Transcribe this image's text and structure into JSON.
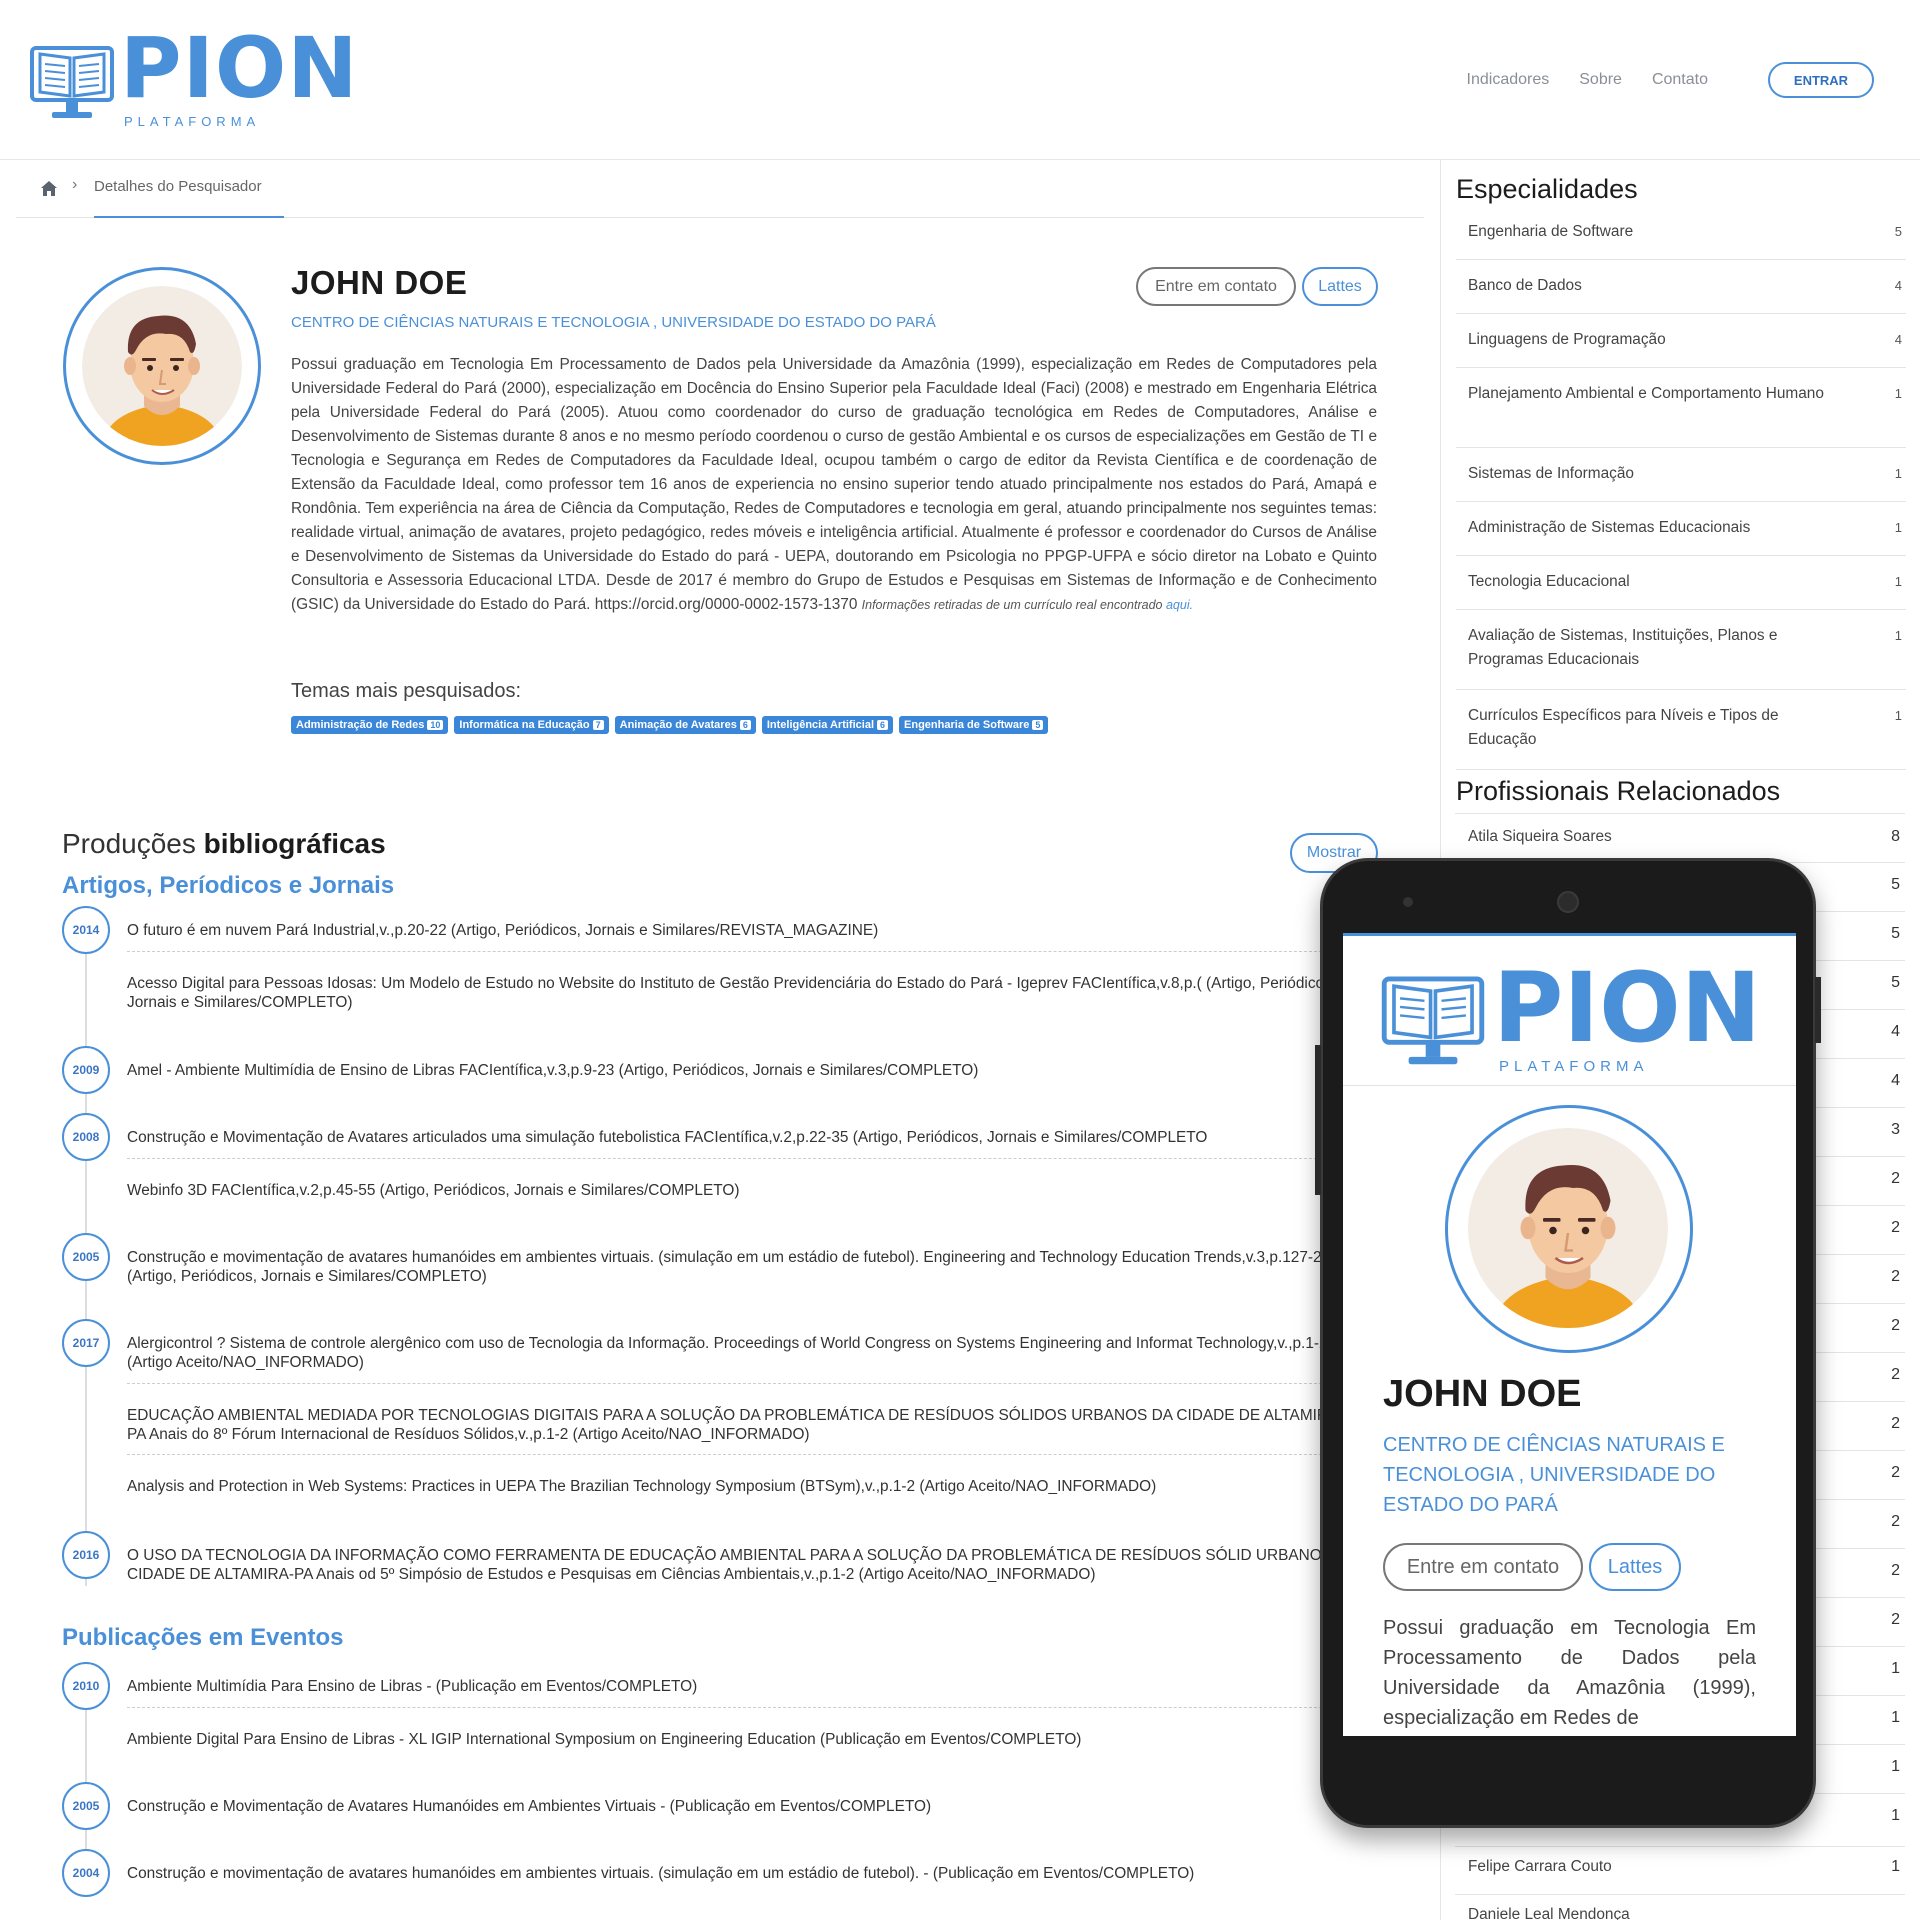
{
  "header": {
    "logo_word": "PION",
    "logo_sub": "PLATAFORMA",
    "nav": [
      "Indicadores",
      "Sobre",
      "Contato"
    ],
    "login_label": "ENTRAR"
  },
  "breadcrumb": {
    "label": "Detalhes do Pesquisador"
  },
  "profile": {
    "name": "JOHN DOE",
    "affiliation": "CENTRO DE CIÊNCIAS NATURAIS E TECNOLOGIA  , UNIVERSIDADE DO ESTADO DO PARÁ",
    "contact_label": "Entre em contato",
    "lattes_label": "Lattes",
    "bio": "Possui graduação em Tecnologia Em Processamento de Dados pela Universidade da Amazônia (1999), especialização em Redes de Computadores pela Universidade Federal do Pará (2000), especialização em Docência do Ensino Superior pela Faculdade Ideal (Faci) (2008) e mestrado em Engenharia Elétrica pela Universidade Federal do Pará (2005). Atuou como coordenador do curso de graduação tecnológica em Redes de Computadores, Análise e Desenvolvimento de Sistemas durante 8 anos e no mesmo período coordenou o curso de gestão Ambiental e os cursos de especializações em Gestão de TI e Tecnologia e Segurança em Redes de Computadores da Faculdade Ideal, ocupou também o cargo de editor da Revista Científica e de coordenação de Extensão da Faculdade Ideal, como professor tem 16 anos de experiencia no ensino superior tendo atuado principalmente nos estados do Pará, Amapá e Rondônia. Tem experiência na área de Ciência da Computação, Redes de Computadores e tecnologia em geral, atuando principalmente nos seguintes temas: realidade virtual, animação de avatares, projeto pedagógico, redes móveis e inteligência artificial. Atualmente é professor e coordenador do Cursos de Análise e Desenvolvimento de Sistemas da Universidade do Estado do pará - UEPA, doutorando em Psicologia no PPGP-UFPA e sócio diretor na Lobato e Quinto Consultoria e Assessoria Educacional LTDA. Desde de 2017 é membro do Grupo de Estudos e Pesquisas em Sistemas de Informação e de Conhecimento (GSIC) da Universidade do Estado do Pará. https://orcid.org/0000-0002-1573-1370",
    "bio_note": "Informações retiradas de um currículo real encontrado",
    "bio_note_link": "aqui.",
    "themes_title": "Temas mais pesquisados:",
    "themes": [
      {
        "label": "Administração de Redes",
        "count": "10"
      },
      {
        "label": "Informática na Educação",
        "count": "7"
      },
      {
        "label": "Animação de Avatares",
        "count": "6"
      },
      {
        "label": "Inteligência Artificial",
        "count": "6"
      },
      {
        "label": "Engenharia de Software",
        "count": "5"
      }
    ]
  },
  "productions": {
    "title_light": "Produções",
    "title_bold": "bibliográficas",
    "show_label": "Mostrar",
    "articles_title": "Artigos, Períodicos e Jornais",
    "articles": [
      {
        "year": "2014",
        "text": "O futuro é em nuvem Pará Industrial,v.,p.20-22 (Artigo, Periódicos, Jornais e Similares/REVISTA_MAGAZINE)"
      },
      {
        "year": "",
        "text": "Acesso Digital para Pessoas Idosas: Um Modelo de Estudo no Website do Instituto de Gestão Previdenciária do Estado do Pará - Igeprev FACIentífica,v.8,p.( (Artigo, Periódicos, Jornais e Similares/COMPLETO)"
      },
      {
        "year": "2009",
        "text": "Amel - Ambiente Multimídia de Ensino de Libras FACIentífica,v.3,p.9-23 (Artigo, Periódicos, Jornais e Similares/COMPLETO)"
      },
      {
        "year": "2008",
        "text": "Construção e Movimentação de Avatares articulados uma simulação futebolistica FACIentífica,v.2,p.22-35 (Artigo, Periódicos, Jornais e Similares/COMPLETO"
      },
      {
        "year": "",
        "text": "Webinfo 3D FACIentífica,v.2,p.45-55 (Artigo, Periódicos, Jornais e Similares/COMPLETO)"
      },
      {
        "year": "2005",
        "text": "Construção e movimentação de avatares humanóides em ambientes virtuais. (simulação em um estádio de futebol). Engineering and Technology Education Trends,v.3,p.127-2 (Artigo, Periódicos, Jornais e Similares/COMPLETO)"
      },
      {
        "year": "2017",
        "text": "Alergicontrol ? Sistema de controle alergênico com uso de Tecnologia da Informação. Proceedings of World Congress on Systems Engineering and Informat Technology,v.,p.1-2 (Artigo Aceito/NAO_INFORMADO)"
      },
      {
        "year": "",
        "text": "EDUCAÇÃO AMBIENTAL MEDIADA POR TECNOLOGIAS DIGITAIS PARA A SOLUÇÃO DA PROBLEMÁTICA DE RESÍDUOS SÓLIDOS URBANOS DA CIDADE DE ALTAMIRA-PA Anais do 8º Fórum Internacional de Resíduos Sólidos,v.,p.1-2 (Artigo Aceito/NAO_INFORMADO)"
      },
      {
        "year": "",
        "text": "Analysis and Protection in Web Systems: Practices in UEPA The Brazilian Technology Symposium (BTSym),v.,p.1-2 (Artigo Aceito/NAO_INFORMADO)"
      },
      {
        "year": "2016",
        "text": "O USO DA TECNOLOGIA DA INFORMAÇÃO COMO FERRAMENTA DE EDUCAÇÃO AMBIENTAL PARA A SOLUÇÃO DA PROBLEMÁTICA DE RESÍDUOS SÓLID URBANOS DA CIDADE DE ALTAMIRA-PA Anais od 5º Simpósio de Estudos e Pesquisas em Ciências Ambientais,v.,p.1-2 (Artigo Aceito/NAO_INFORMADO)"
      }
    ],
    "events_title": "Publicações em Eventos",
    "events": [
      {
        "year": "2010",
        "text": "Ambiente Multimídia Para Ensino de Libras - (Publicação em Eventos/COMPLETO)"
      },
      {
        "year": "",
        "text": "Ambiente Digital Para Ensino de Libras - XL IGIP International Symposium on Engineering Education (Publicação em Eventos/COMPLETO)"
      },
      {
        "year": "2005",
        "text": "Construção e Movimentação de Avatares Humanóides em Ambientes Virtuais - (Publicação em Eventos/COMPLETO)"
      },
      {
        "year": "2004",
        "text": "Construção e movimentação de avatares humanóides em ambientes virtuais. (simulação em um estádio de futebol). - (Publicação em Eventos/COMPLETO)"
      }
    ]
  },
  "sidebar": {
    "specialties_title": "Especialidades",
    "specialties": [
      {
        "label": "Engenharia de Software",
        "count": "5"
      },
      {
        "label": "Banco de Dados",
        "count": "4"
      },
      {
        "label": "Linguagens de Programação",
        "count": "4"
      },
      {
        "label": "Planejamento Ambiental e Comportamento Humano",
        "count": "1"
      },
      {
        "label": "Sistemas de Informação",
        "count": "1"
      },
      {
        "label": "Administração de Sistemas Educacionais",
        "count": "1"
      },
      {
        "label": "Tecnologia Educacional",
        "count": "1"
      },
      {
        "label": "Avaliação de Sistemas, Instituições, Planos e Programas Educacionais",
        "count": "1"
      },
      {
        "label": "Currículos Específicos para Níveis e Tipos de Educação",
        "count": "1"
      }
    ],
    "related_title": "Profissionais Relacionados",
    "related_first": {
      "name": "Atila Siqueira Soares",
      "count": "8"
    },
    "related_counts": [
      "5",
      "5",
      "5",
      "4",
      "4",
      "3",
      "2",
      "2",
      "2",
      "2",
      "2",
      "2",
      "2",
      "2",
      "2",
      "2",
      "1",
      "1",
      "1",
      "1"
    ],
    "related_last": {
      "name": "Felipe Carrara Couto",
      "count": "1"
    },
    "related_cut": {
      "name": "Daniele Leal Mendonça"
    }
  },
  "mobile": {
    "bio_excerpt": "Possui graduação em Tecnologia Em Processamento de Dados pela Universidade da Amazônia (1999), especialização em Redes de"
  },
  "colors": {
    "accent": "#4a90d9",
    "text": "#333333",
    "tag_bg": "#3a86d8"
  },
  "icons": [
    "home-icon",
    "chevron-right-icon",
    "book-monitor-logo-icon",
    "avatar-illustration"
  ]
}
